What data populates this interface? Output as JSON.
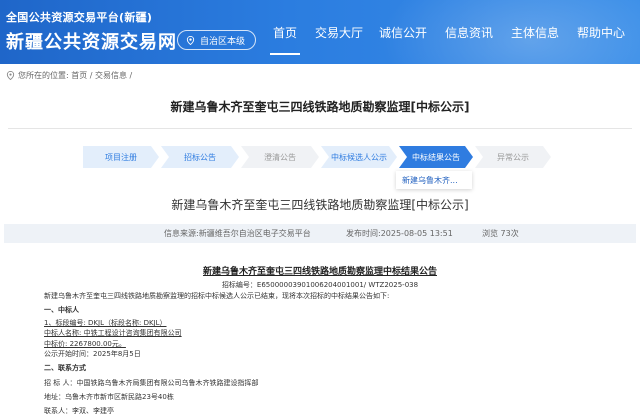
{
  "header": {
    "brand_line1": "全国公共资源交易平台(新疆)",
    "brand_line2": "新疆公共资源交易网",
    "region": "自治区本级",
    "nav": [
      {
        "label": "首页",
        "active": true
      },
      {
        "label": "交易大厅"
      },
      {
        "label": "诚信公开"
      },
      {
        "label": "信息资讯"
      },
      {
        "label": "主体信息"
      },
      {
        "label": "帮助中心"
      }
    ]
  },
  "breadcrumb": "您所在的位置: 首页 / 交易信息 /",
  "page_title": "新建乌鲁木齐至奎屯三四线铁路地质勘察监理[中标公示]",
  "steps": [
    {
      "label": "项目注册",
      "state": "done"
    },
    {
      "label": "招标公告",
      "state": "done"
    },
    {
      "label": "澄清公告",
      "state": "inactive"
    },
    {
      "label": "中标候选人公示",
      "state": "done"
    },
    {
      "label": "中标结果公告",
      "state": "current"
    },
    {
      "label": "异常公示",
      "state": "inactive"
    }
  ],
  "step_dropdown": "新建乌鲁木齐...",
  "content_title": "新建乌鲁木齐至奎屯三四线铁路地质勘察监理[中标公示]",
  "info": {
    "source": "信息来源:新疆维吾尔自治区电子交易平台",
    "publish_time": "发布时间:2025-08-05 13:51",
    "views": "浏览 73次"
  },
  "announcement": {
    "title": "新建乌鲁木齐至奎屯三四线铁路地质勘察监理中标结果公告",
    "bid_code": "招标编号：E6500000390100620400100​1/ WTZ2025-038",
    "intro": "新建乌鲁木齐至奎屯三四线铁路地质勘察监理的招标中标候选人公示已结束，现将本次招标的中标结果公告如下:",
    "section1": "一、中标人",
    "lot": "1、标段编号: DKJL（标段名称: DKJL）",
    "winner": "中标人名称: 中铁工程设计咨询集团有限公司",
    "price": "中标价: 2267800.00元。",
    "start_date": "公示开始时间：2025年8月5日",
    "section2": "二、联系方式",
    "tenderer": "招 标 人：中国铁路乌鲁木齐局集团有限公司乌鲁木齐铁路建设指挥部",
    "address": "地址：乌鲁木齐市新市区新民路23号40栋",
    "contact": "联系人：李双、李建亭"
  },
  "colors": {
    "header_blue": "#2b7de0",
    "step_blue": "#2f7ce0",
    "step_done_bg": "#e3eefb",
    "step_inactive_bg": "#f0f2f5"
  }
}
